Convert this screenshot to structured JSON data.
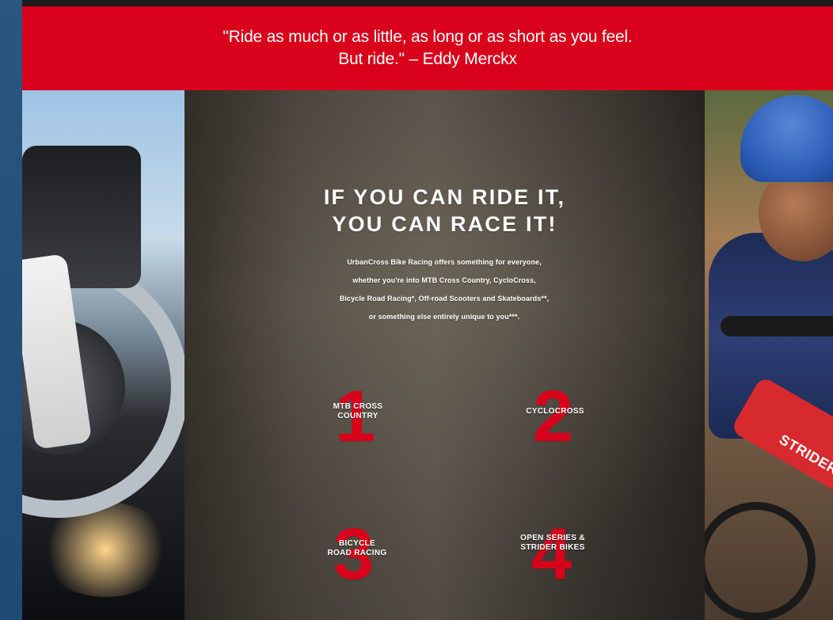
{
  "banner": {
    "quote_line1": "\"Ride as much or as little, as long or as short as you feel.",
    "quote_line2": "But ride.\" – Eddy Merckx"
  },
  "hero": {
    "headline_line1": "IF YOU CAN RIDE IT,",
    "headline_line2": "YOU CAN RACE IT!",
    "description_lines": [
      "UrbanCross Bike Racing offers something for everyone,",
      "whether you're into MTB Cross Country, CycloCross,",
      "Bicycle Road Racing*, Off-road Scooters and Skateboards**,",
      "or something else entirely unique to you***."
    ]
  },
  "categories": [
    {
      "number": "1",
      "label_line1": "MTB CROSS",
      "label_line2": "COUNTRY"
    },
    {
      "number": "2",
      "label_line1": "CYCLOCROSS",
      "label_line2": ""
    },
    {
      "number": "3",
      "label_line1": "BICYCLE",
      "label_line2": "ROAD RACING"
    },
    {
      "number": "4",
      "label_line1": "OPEN SERIES &",
      "label_line2": "STRIDER BIKES"
    }
  ],
  "photos": {
    "right_brand_text": "STRIDER"
  },
  "colors": {
    "accent_red": "#d8001a",
    "rail_blue": "#234a71"
  }
}
